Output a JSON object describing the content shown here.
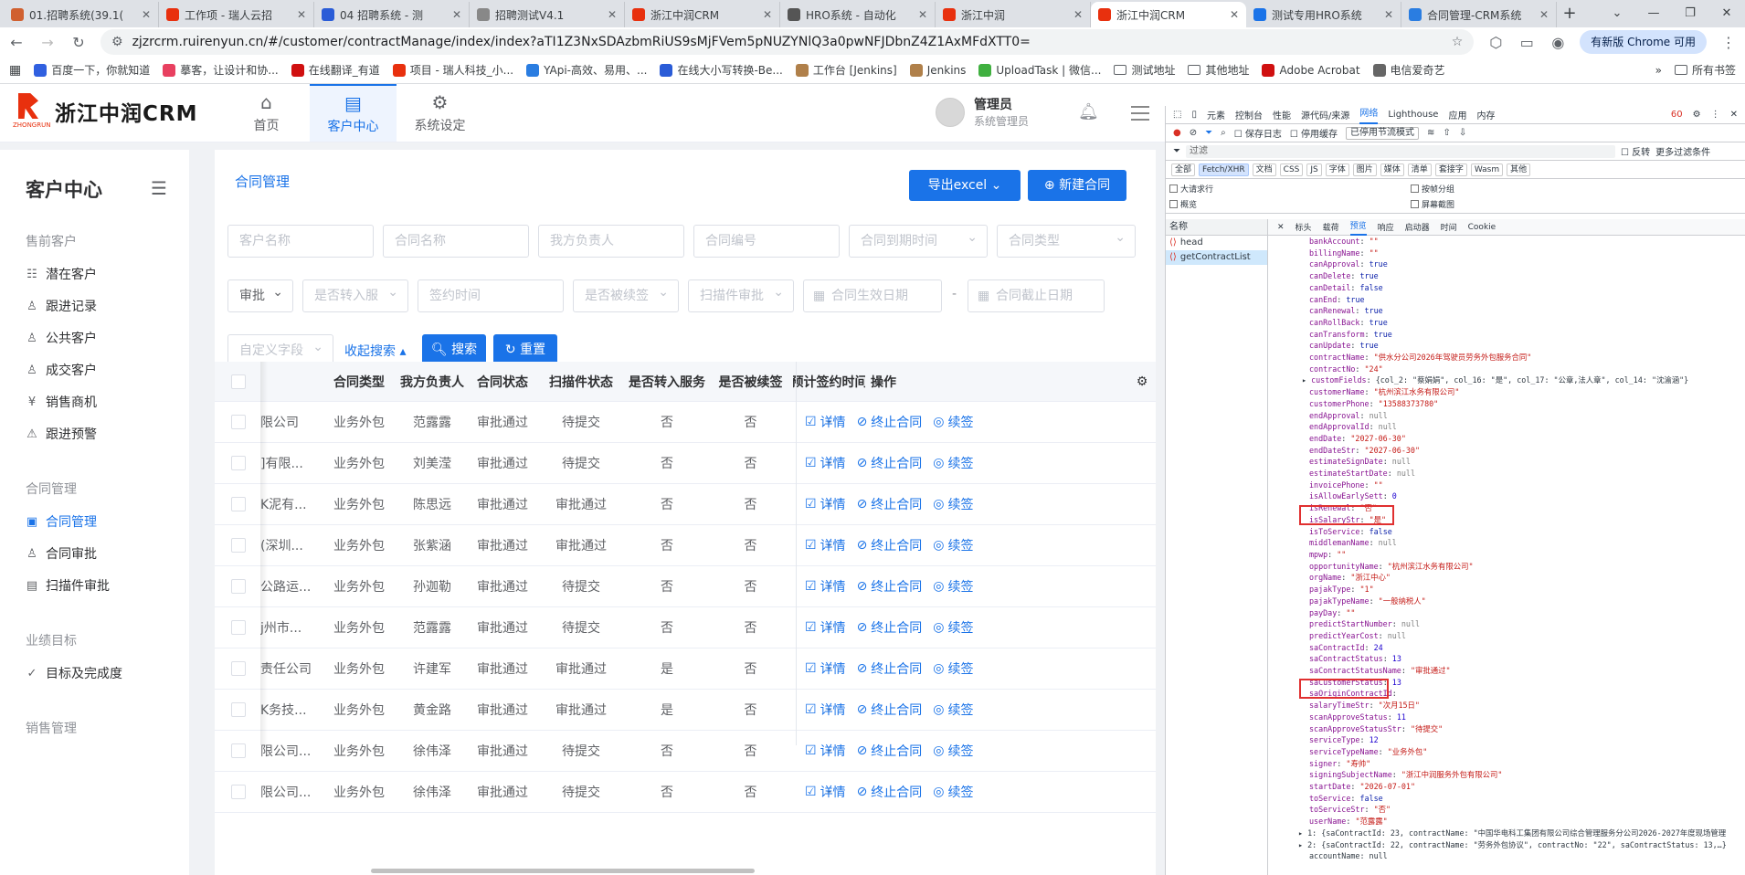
{
  "browser": {
    "tabs": [
      {
        "title": "01.招聘系统(39.1(",
        "color": "#d06030",
        "icon": "person-icon"
      },
      {
        "title": "工作项 - 瑞人云招",
        "color": "#e8300e",
        "icon": "tencent-icon"
      },
      {
        "title": "04 招聘系统 - 测",
        "color": "#2a5cd7",
        "icon": "x-icon"
      },
      {
        "title": "招聘测试V4.1",
        "color": "#888888",
        "icon": "globe-icon"
      },
      {
        "title": "浙江中润CRM",
        "color": "#e8300e",
        "icon": "doc-icon"
      },
      {
        "title": "HRO系统 - 自动化",
        "color": "#555555",
        "icon": "page-icon"
      },
      {
        "title": "浙江中润",
        "color": "#e8300e",
        "icon": "doc-icon"
      },
      {
        "title": "浙江中润CRM",
        "color": "#e8300e",
        "icon": "doc-icon",
        "active": true
      },
      {
        "title": "测试专用HRO系统",
        "color": "#1a73e8",
        "icon": "link-icon"
      },
      {
        "title": "合同管理-CRM系统",
        "color": "#2a7de1",
        "icon": "crm-icon"
      }
    ],
    "url": "zjzrcrm.ruirenyun.cn/#/customer/contractManage/index/index?aTI1Z3NxSDAzbmRiUS9sMjFVem5pNUZYNlQ3a0pwNFJDbnZ4Z1AxMFdXTT0=",
    "update_label": "有新版 Chrome 可用",
    "bookmarks": [
      {
        "label": "百度一下，你就知道",
        "color": "#3060e0"
      },
      {
        "label": "摹客，让设计和协...",
        "color": "#e84060"
      },
      {
        "label": "在线翻译_有道",
        "color": "#d01010"
      },
      {
        "label": "项目 - 瑞人科技_小...",
        "color": "#e8300e"
      },
      {
        "label": "YApi-高效、易用、...",
        "color": "#2a7de1"
      },
      {
        "label": "在线大小写转换-Be...",
        "color": "#2a5cd7"
      },
      {
        "label": "工作台 [Jenkins]",
        "color": "#b0804a"
      },
      {
        "label": "Jenkins",
        "color": "#b0804a"
      },
      {
        "label": "UploadTask | 微信...",
        "color": "#40b040"
      },
      {
        "label": "测试地址",
        "folder": true
      },
      {
        "label": "其他地址",
        "folder": true
      },
      {
        "label": "Adobe Acrobat",
        "color": "#d01010"
      },
      {
        "label": "电信爱奇艺",
        "color": "#666666"
      }
    ],
    "bookmarks_all": "所有书签"
  },
  "app": {
    "logo_text": "浙江中润CRM",
    "logo_sub": "ZHONGRUN",
    "nav": [
      {
        "label": "首页",
        "icon": "home-icon"
      },
      {
        "label": "客户中心",
        "icon": "contract-icon",
        "active": true
      },
      {
        "label": "系统设定",
        "icon": "gear-icon"
      }
    ],
    "user": {
      "name": "管理员",
      "role": "系统管理员"
    }
  },
  "sidebar": {
    "title": "客户中心",
    "groups": [
      {
        "label": "售前客户",
        "items": [
          {
            "label": "潜在客户",
            "icon": "id-card-icon"
          },
          {
            "label": "跟进记录",
            "icon": "user-icon"
          },
          {
            "label": "公共客户",
            "icon": "user-icon"
          },
          {
            "label": "成交客户",
            "icon": "user-icon"
          },
          {
            "label": "销售商机",
            "icon": "yen-icon"
          },
          {
            "label": "跟进预警",
            "icon": "alert-icon"
          }
        ]
      },
      {
        "label": "合同管理",
        "items": [
          {
            "label": "合同管理",
            "icon": "doc-icon",
            "active": true
          },
          {
            "label": "合同审批",
            "icon": "user-icon"
          },
          {
            "label": "扫描件审批",
            "icon": "scan-icon"
          }
        ]
      },
      {
        "label": "业绩目标",
        "items": [
          {
            "label": "目标及完成度",
            "icon": "check-icon"
          }
        ]
      },
      {
        "label": "销售管理",
        "items": []
      }
    ]
  },
  "main": {
    "title": "合同管理",
    "export_label": "导出excel",
    "new_label": "新建合同",
    "filters_row1": [
      "客户名称",
      "合同名称",
      "我方负责人",
      "合同编号",
      "合同到期时间",
      "合同类型"
    ],
    "filters_row2": [
      "审批",
      "是否转入服",
      "签约时间",
      "是否被续签",
      "扫描件审批",
      "合同生效日期",
      "合同截止日期"
    ],
    "range_sep": "-",
    "custom_field": "自定义字段",
    "collapse_label": "收起搜索",
    "search_label": "搜索",
    "reset_label": "重置",
    "columns": [
      "合同类型",
      "我方负责人",
      "合同状态",
      "扫描件状态",
      "是否转入服务",
      "是否被续签",
      "预计签约时间",
      "操作"
    ],
    "rows": [
      [
        "限公司",
        "业务外包",
        "范露露",
        "审批通过",
        "待提交",
        "否",
        "否",
        "-"
      ],
      [
        "]有限...",
        "业务外包",
        "刘美滢",
        "审批通过",
        "待提交",
        "否",
        "否",
        "-"
      ],
      [
        "K泥有...",
        "业务外包",
        "陈思远",
        "审批通过",
        "审批通过",
        "否",
        "否",
        "-"
      ],
      [
        "(深圳...",
        "业务外包",
        "张紫涵",
        "审批通过",
        "审批通过",
        "否",
        "否",
        "-"
      ],
      [
        "公路运...",
        "业务外包",
        "孙迦勒",
        "审批通过",
        "待提交",
        "否",
        "否",
        "-"
      ],
      [
        "j州市...",
        "业务外包",
        "范露露",
        "审批通过",
        "待提交",
        "否",
        "否",
        "-"
      ],
      [
        "责任公司",
        "业务外包",
        "许建军",
        "审批通过",
        "审批通过",
        "是",
        "否",
        "-"
      ],
      [
        "K务技...",
        "业务外包",
        "黄金路",
        "审批通过",
        "审批通过",
        "是",
        "否",
        "-"
      ],
      [
        "限公司...",
        "业务外包",
        "徐伟泽",
        "审批通过",
        "待提交",
        "否",
        "否",
        "-"
      ],
      [
        "限公司...",
        "业务外包",
        "徐伟泽",
        "审批通过",
        "待提交",
        "否",
        "否",
        "-"
      ]
    ],
    "ops": {
      "detail": "详情",
      "terminate": "终止合同",
      "renew": "续签"
    }
  },
  "devtools": {
    "tabs": [
      "元素",
      "控制台",
      "性能",
      "源代码/来源",
      "网络",
      "Lighthouse",
      "应用",
      "内存"
    ],
    "active_tab": "网络",
    "error_count": "60",
    "preserve_log": "保存日志",
    "disable_cache": "停用缓存",
    "throttle": "已停用节流模式",
    "filter_placeholder": "过滤",
    "invert": "反转",
    "more_filters": "更多过滤条件",
    "type_chips": [
      "全部",
      "Fetch/XHR",
      "文档",
      "CSS",
      "JS",
      "字体",
      "图片",
      "媒体",
      "清单",
      "套接字",
      "Wasm",
      "其他"
    ],
    "options": [
      "大请求行",
      "概览",
      "按帧分组",
      "屏幕截图"
    ],
    "name_header": "名称",
    "requests": [
      "head",
      "getContractList"
    ],
    "detail_tabs": [
      "标头",
      "载荷",
      "预览",
      "响应",
      "启动器",
      "时间",
      "Cookie"
    ],
    "active_detail": "预览",
    "json_lines": [
      {
        "k": "bankAccount",
        "v": "\"\"",
        "t": "s"
      },
      {
        "k": "billingName",
        "v": "\"\"",
        "t": "s"
      },
      {
        "k": "canApproval",
        "v": "true",
        "t": "b"
      },
      {
        "k": "canDelete",
        "v": "true",
        "t": "b"
      },
      {
        "k": "canDetail",
        "v": "false",
        "t": "b"
      },
      {
        "k": "canEnd",
        "v": "true",
        "t": "b"
      },
      {
        "k": "canRenewal",
        "v": "true",
        "t": "b"
      },
      {
        "k": "canRollBack",
        "v": "true",
        "t": "b"
      },
      {
        "k": "canTransform",
        "v": "true",
        "t": "b"
      },
      {
        "k": "canUpdate",
        "v": "true",
        "t": "b"
      },
      {
        "k": "contractName",
        "v": "\"供水分公司2026年驾驶员劳务外包服务合同\"",
        "t": "s"
      },
      {
        "k": "contractNo",
        "v": "\"24\"",
        "t": "s"
      },
      {
        "k": "customFields",
        "v": "{col_2: \"蔡娟娟\", col_16: \"是\", col_17: \"公章,法人章\", col_14: \"沈渝涵\"}",
        "t": "o",
        "arrow": true
      },
      {
        "k": "customerName",
        "v": "\"杭州滨江水务有限公司\"",
        "t": "s"
      },
      {
        "k": "customerPhone",
        "v": "\"13588373780\"",
        "t": "s"
      },
      {
        "k": "endApproval",
        "v": "null",
        "t": "l"
      },
      {
        "k": "endApprovalId",
        "v": "null",
        "t": "l"
      },
      {
        "k": "endDate",
        "v": "\"2027-06-30\"",
        "t": "s"
      },
      {
        "k": "endDateStr",
        "v": "\"2027-06-30\"",
        "t": "s"
      },
      {
        "k": "estimateSignDate",
        "v": "null",
        "t": "l"
      },
      {
        "k": "estimateStartDate",
        "v": "null",
        "t": "l"
      },
      {
        "k": "invoicePhone",
        "v": "\"\"",
        "t": "s"
      },
      {
        "k": "isAllowEarlySett",
        "v": "0",
        "t": "n"
      },
      {
        "k": "isRenewal",
        "v": "\"否\"",
        "t": "s"
      },
      {
        "k": "isSalaryStr",
        "v": "\"是\"",
        "t": "s"
      },
      {
        "k": "isToService",
        "v": "false",
        "t": "b"
      },
      {
        "k": "middlemanName",
        "v": "null",
        "t": "l"
      },
      {
        "k": "mpwp",
        "v": "\"\"",
        "t": "s"
      },
      {
        "k": "opportunityName",
        "v": "\"杭州滨江水务有限公司\"",
        "t": "s"
      },
      {
        "k": "orgName",
        "v": "\"浙江中心\"",
        "t": "s"
      },
      {
        "k": "pajakType",
        "v": "\"1\"",
        "t": "s"
      },
      {
        "k": "pajakTypeName",
        "v": "\"一般纳税人\"",
        "t": "s"
      },
      {
        "k": "payDay",
        "v": "\"\"",
        "t": "s"
      },
      {
        "k": "predictStartNumber",
        "v": "null",
        "t": "l"
      },
      {
        "k": "predictYearCost",
        "v": "null",
        "t": "l"
      },
      {
        "k": "saContractId",
        "v": "24",
        "t": "n"
      },
      {
        "k": "saContractStatus",
        "v": "13",
        "t": "n"
      },
      {
        "k": "saContractStatusName",
        "v": "\"审批通过\"",
        "t": "s"
      },
      {
        "k": "saCustomerStatus",
        "v": "13",
        "t": "n"
      },
      {
        "k": "saOriginContractId",
        "v": "",
        "t": "n"
      },
      {
        "k": "salaryTimeStr",
        "v": "\"次月15日\"",
        "t": "s"
      },
      {
        "k": "scanApproveStatus",
        "v": "11",
        "t": "n"
      },
      {
        "k": "scanApproveStatusStr",
        "v": "\"待提交\"",
        "t": "s"
      },
      {
        "k": "serviceType",
        "v": "12",
        "t": "n"
      },
      {
        "k": "serviceTypeName",
        "v": "\"业务外包\"",
        "t": "s"
      },
      {
        "k": "signer",
        "v": "\"寿帅\"",
        "t": "s"
      },
      {
        "k": "signingSubjectName",
        "v": "\"浙江中润服务外包有限公司\"",
        "t": "s"
      },
      {
        "k": "startDate",
        "v": "\"2026-07-01\"",
        "t": "s"
      },
      {
        "k": "toService",
        "v": "false",
        "t": "b"
      },
      {
        "k": "toServiceStr",
        "v": "\"否\"",
        "t": "s"
      },
      {
        "k": "userName",
        "v": "\"范露露\"",
        "t": "s"
      }
    ],
    "tail_lines": [
      "▸ 1: {saContractId: 23, contractName: \"中国华电科工集团有限公司综合管理服务分公司2026-2027年度现场管理",
      "▸ 2: {saContractId: 22, contractName: \"劳务外包协议\", contractNo: \"22\", saContractStatus: 13,…}",
      "accountName: null"
    ]
  }
}
